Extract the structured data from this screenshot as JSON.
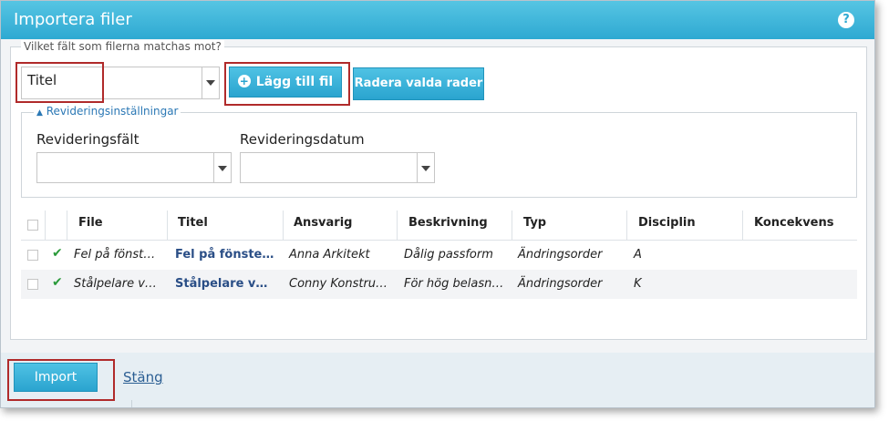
{
  "dialog": {
    "title": "Importera filer",
    "help_glyph": "?"
  },
  "match": {
    "legend": "Vilket fält som filerna matchas mot?",
    "selected_value": "Titel"
  },
  "buttons": {
    "add_file_label": "Lägg till fil",
    "delete_rows_label": "Radera valda rader",
    "import_label": "Import",
    "close_label": "Stäng"
  },
  "revision": {
    "legend": "Revideringsinställningar",
    "field_label": "Revideringsfält",
    "date_label": "Revideringsdatum",
    "field_value": "",
    "date_value": ""
  },
  "table": {
    "headers": [
      "File",
      "Titel",
      "Ansvarig",
      "Beskrivning",
      "Typ",
      "Disciplin",
      "Koncekvens"
    ],
    "rows": [
      {
        "file": "Fel på fönst…",
        "title": "Fel på fönste…",
        "owner": "Anna Arkitekt",
        "description": "Dålig passform",
        "type": "Ändringsorder",
        "discipline": "A",
        "consequence": ""
      },
      {
        "file": "Stålpelare v…",
        "title": "Stålpelare v…",
        "owner": "Conny Konstru…",
        "description": "För hög belasn…",
        "type": "Ändringsorder",
        "discipline": "K",
        "consequence": ""
      }
    ]
  },
  "icons": {
    "help": "help-icon",
    "add": "plus-circle-icon",
    "row_status": "checkmark-icon",
    "dropdown": "chevron-down-icon"
  },
  "colors": {
    "header": "#2ea9d2",
    "button": "#2aa4cf",
    "highlight": "#b02a2a",
    "check": "#2a9a3a",
    "link": "#2b5e93"
  }
}
